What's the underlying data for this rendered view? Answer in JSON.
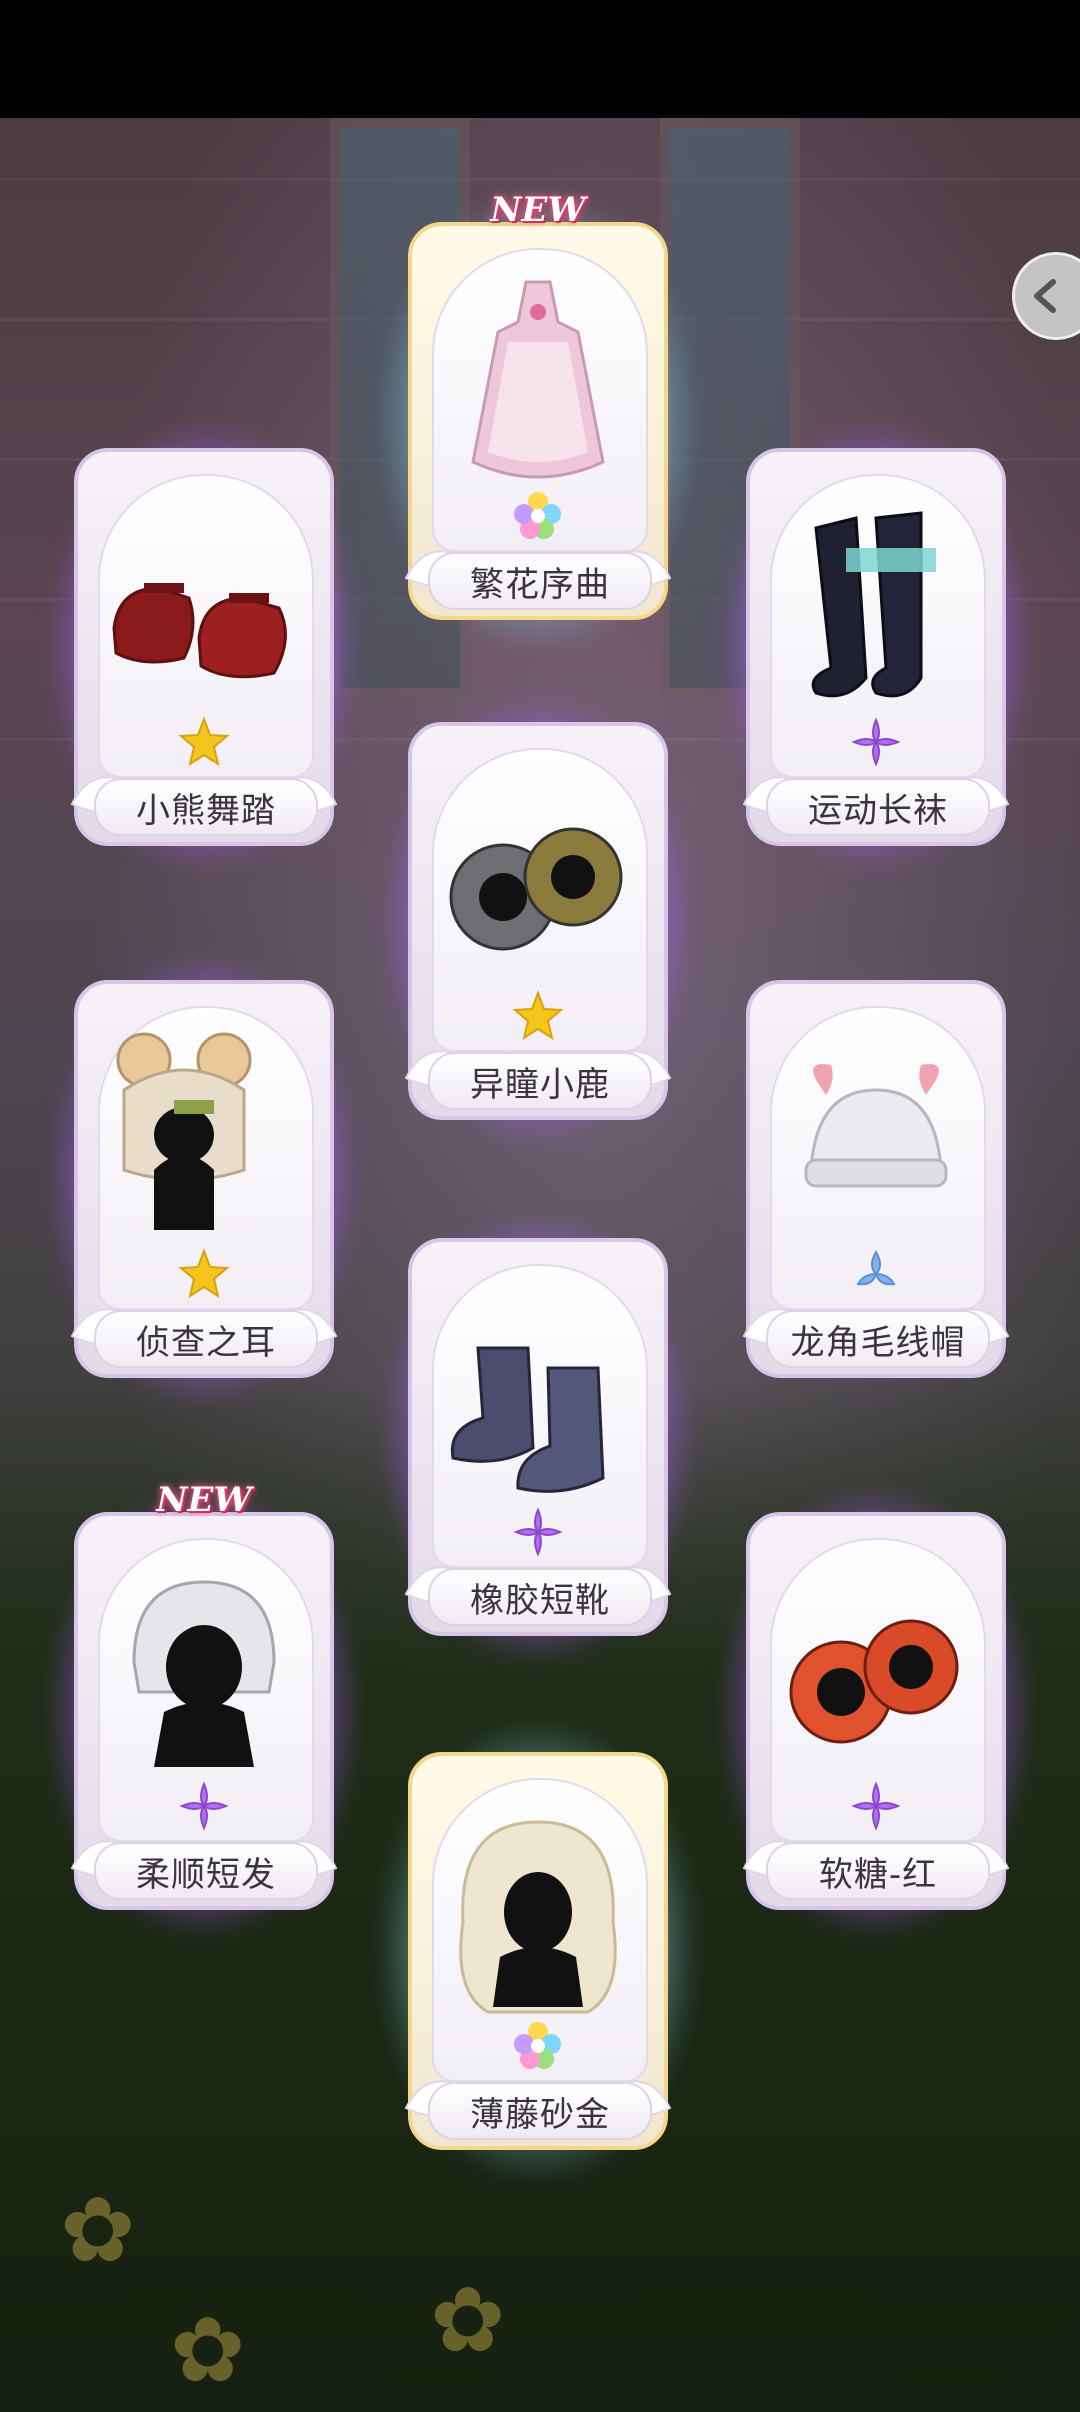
{
  "cards": [
    {
      "name": "繁花序曲",
      "rarity": "rainbow",
      "new": true
    },
    {
      "name": "小熊舞踏",
      "rarity": "gold",
      "new": false
    },
    {
      "name": "运动长袜",
      "rarity": "purple",
      "new": false
    },
    {
      "name": "异瞳小鹿",
      "rarity": "gold",
      "new": false
    },
    {
      "name": "侦查之耳",
      "rarity": "gold",
      "new": false
    },
    {
      "name": "龙角毛线帽",
      "rarity": "blue",
      "new": false
    },
    {
      "name": "橡胶短靴",
      "rarity": "purple",
      "new": false
    },
    {
      "name": "柔顺短发",
      "rarity": "purple",
      "new": true
    },
    {
      "name": "软糖-红",
      "rarity": "purple",
      "new": false
    },
    {
      "name": "薄藤砂金",
      "rarity": "rainbow",
      "new": false
    }
  ],
  "new_badge": "NEW",
  "icons": {
    "back": "chevron-left-icon",
    "rarity_gold": "gold-star-icon",
    "rarity_purple": "purple-star-icon",
    "rarity_blue": "blue-star-icon",
    "rarity_rainbow": "rainbow-flower-icon"
  },
  "colors": {
    "glow_purple": "#b060ff",
    "glow_gold": "#ffe68c",
    "star_gold": "#f5c51e",
    "star_purple": "#b26ef0",
    "star_blue": "#7fb3ee"
  }
}
